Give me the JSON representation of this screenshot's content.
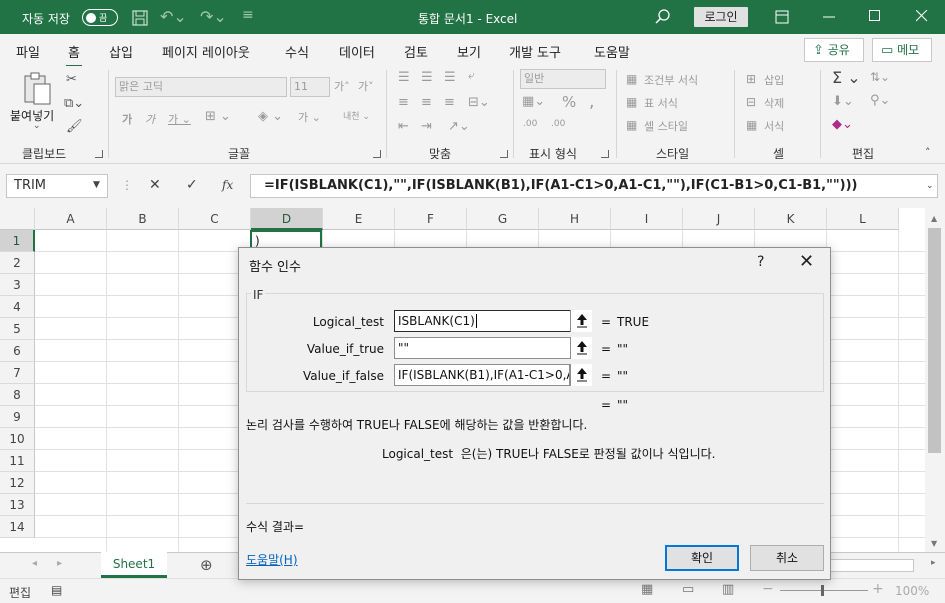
{
  "titlebar": {
    "autosave": "자동 저장",
    "toggle": "끔",
    "title": "통합 문서1  -  Excel",
    "login": "로그인"
  },
  "tabs": [
    "파일",
    "홈",
    "삽입",
    "페이지 레이아웃",
    "수식",
    "데이터",
    "검토",
    "보기",
    "개발 도구",
    "도움말"
  ],
  "share_label": "공유",
  "memo_label": "메모",
  "ribbon": {
    "paste_label": "붙여넣기",
    "font_name": "맑은 고딕",
    "font_size": "11",
    "number_format": "일반",
    "cond_format": "조건부 서식",
    "table_format": "표 서식",
    "cell_style": "셀 스타일",
    "insert": "삽입",
    "delete": "삭제",
    "format": "서식",
    "groups": {
      "clipboard": "클립보드",
      "font": "글꼴",
      "align": "맞춤",
      "number": "표시 형식",
      "style": "스타일",
      "cells": "셀",
      "edit": "편집"
    }
  },
  "formula_bar": {
    "name_box": "TRIM",
    "fx": "fx",
    "formula": "=IF(ISBLANK(C1),\"\",IF(ISBLANK(B1),IF(A1-C1>0,A1-C1,\"\"),IF(C1-B1>0,C1-B1,\"\")))"
  },
  "columns": [
    "A",
    "B",
    "C",
    "D",
    "E",
    "F",
    "G",
    "H",
    "I",
    "J",
    "K",
    "L"
  ],
  "rows": [
    "1",
    "2",
    "3",
    "4",
    "5",
    "6",
    "7",
    "8",
    "9",
    "10",
    "11",
    "12",
    "13",
    "14"
  ],
  "cell_d1": ")",
  "sheet_tab": "Sheet1",
  "status": {
    "mode": "편집",
    "zoom": "100%"
  },
  "dialog": {
    "title": "함수 인수",
    "help_q": "?",
    "function_name": "IF",
    "args": [
      {
        "label": "Logical_test",
        "value": "ISBLANK(C1)",
        "result": "TRUE"
      },
      {
        "label": "Value_if_true",
        "value": "\"\"",
        "result": "\"\""
      },
      {
        "label": "Value_if_false",
        "value": "IF(ISBLANK(B1),IF(A1-C1>0,A1",
        "result": "\"\""
      }
    ],
    "overall_result": "\"\"",
    "equals": "=",
    "description": "논리 검사를 수행하여 TRUE나 FALSE에 해당하는 값을 반환합니다.",
    "arg_name": "Logical_test",
    "arg_description": "은(는) TRUE나 FALSE로 판정될 값이나 식입니다.",
    "formula_result_label": "수식 결과=",
    "help_link": "도움말(H)",
    "ok": "확인",
    "cancel": "취소"
  }
}
